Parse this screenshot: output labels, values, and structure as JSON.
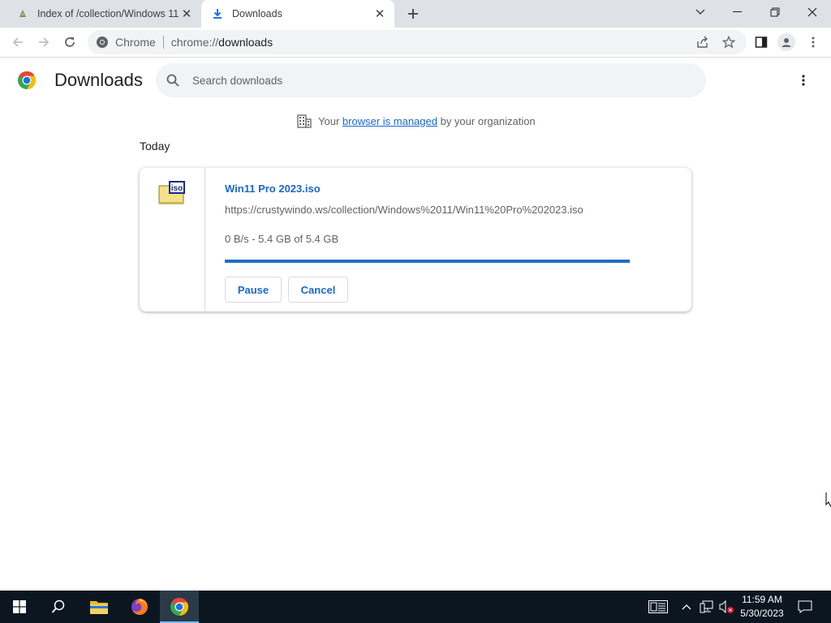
{
  "tabs": [
    {
      "title": "Index of /collection/Windows 11",
      "active": false,
      "icon": "page-favicon-icon"
    },
    {
      "title": "Downloads",
      "active": true,
      "icon": "download-icon"
    }
  ],
  "window_controls": [
    "tab-search-icon",
    "minimize-icon",
    "restore-icon",
    "close-icon"
  ],
  "toolbar": {
    "chip_label": "Chrome",
    "url_scheme": "chrome://",
    "url_path": "downloads",
    "right_icons": [
      "share-icon",
      "bookmark-star-icon",
      "side-panel-icon",
      "profile-icon",
      "menu-icon"
    ]
  },
  "downloads_page": {
    "title": "Downloads",
    "search_placeholder": "Search downloads",
    "managed_prefix": "Your",
    "managed_link": "browser is managed",
    "managed_suffix": "by your organization",
    "section_label": "Today",
    "items": [
      {
        "file_name": "Win11 Pro 2023.iso",
        "url": "https://crustywindo.ws/collection/Windows%2011/Win11%20Pro%202023.iso",
        "status": "0 B/s - 5.4 GB of 5.4 GB",
        "progress_percent": 100,
        "file_icon_text": "iso",
        "pause_label": "Pause",
        "cancel_label": "Cancel"
      }
    ]
  },
  "taskbar": {
    "apps": [
      "windows-start-icon",
      "search-icon",
      "file-explorer-icon",
      "firefox-icon",
      "chrome-icon"
    ],
    "active_app": "chrome-icon",
    "tray_icons": [
      "news-widget-icon",
      "show-hidden-icons-chevron",
      "network-icon",
      "volume-muted-icon"
    ],
    "time": "11:59 AM",
    "date": "5/30/2023"
  },
  "colors": {
    "accent_blue": "#1967d2",
    "progress_blue": "#1f6fc4",
    "tabstrip_bg": "#dee1e6",
    "taskbar_bg": "#0b1621"
  }
}
